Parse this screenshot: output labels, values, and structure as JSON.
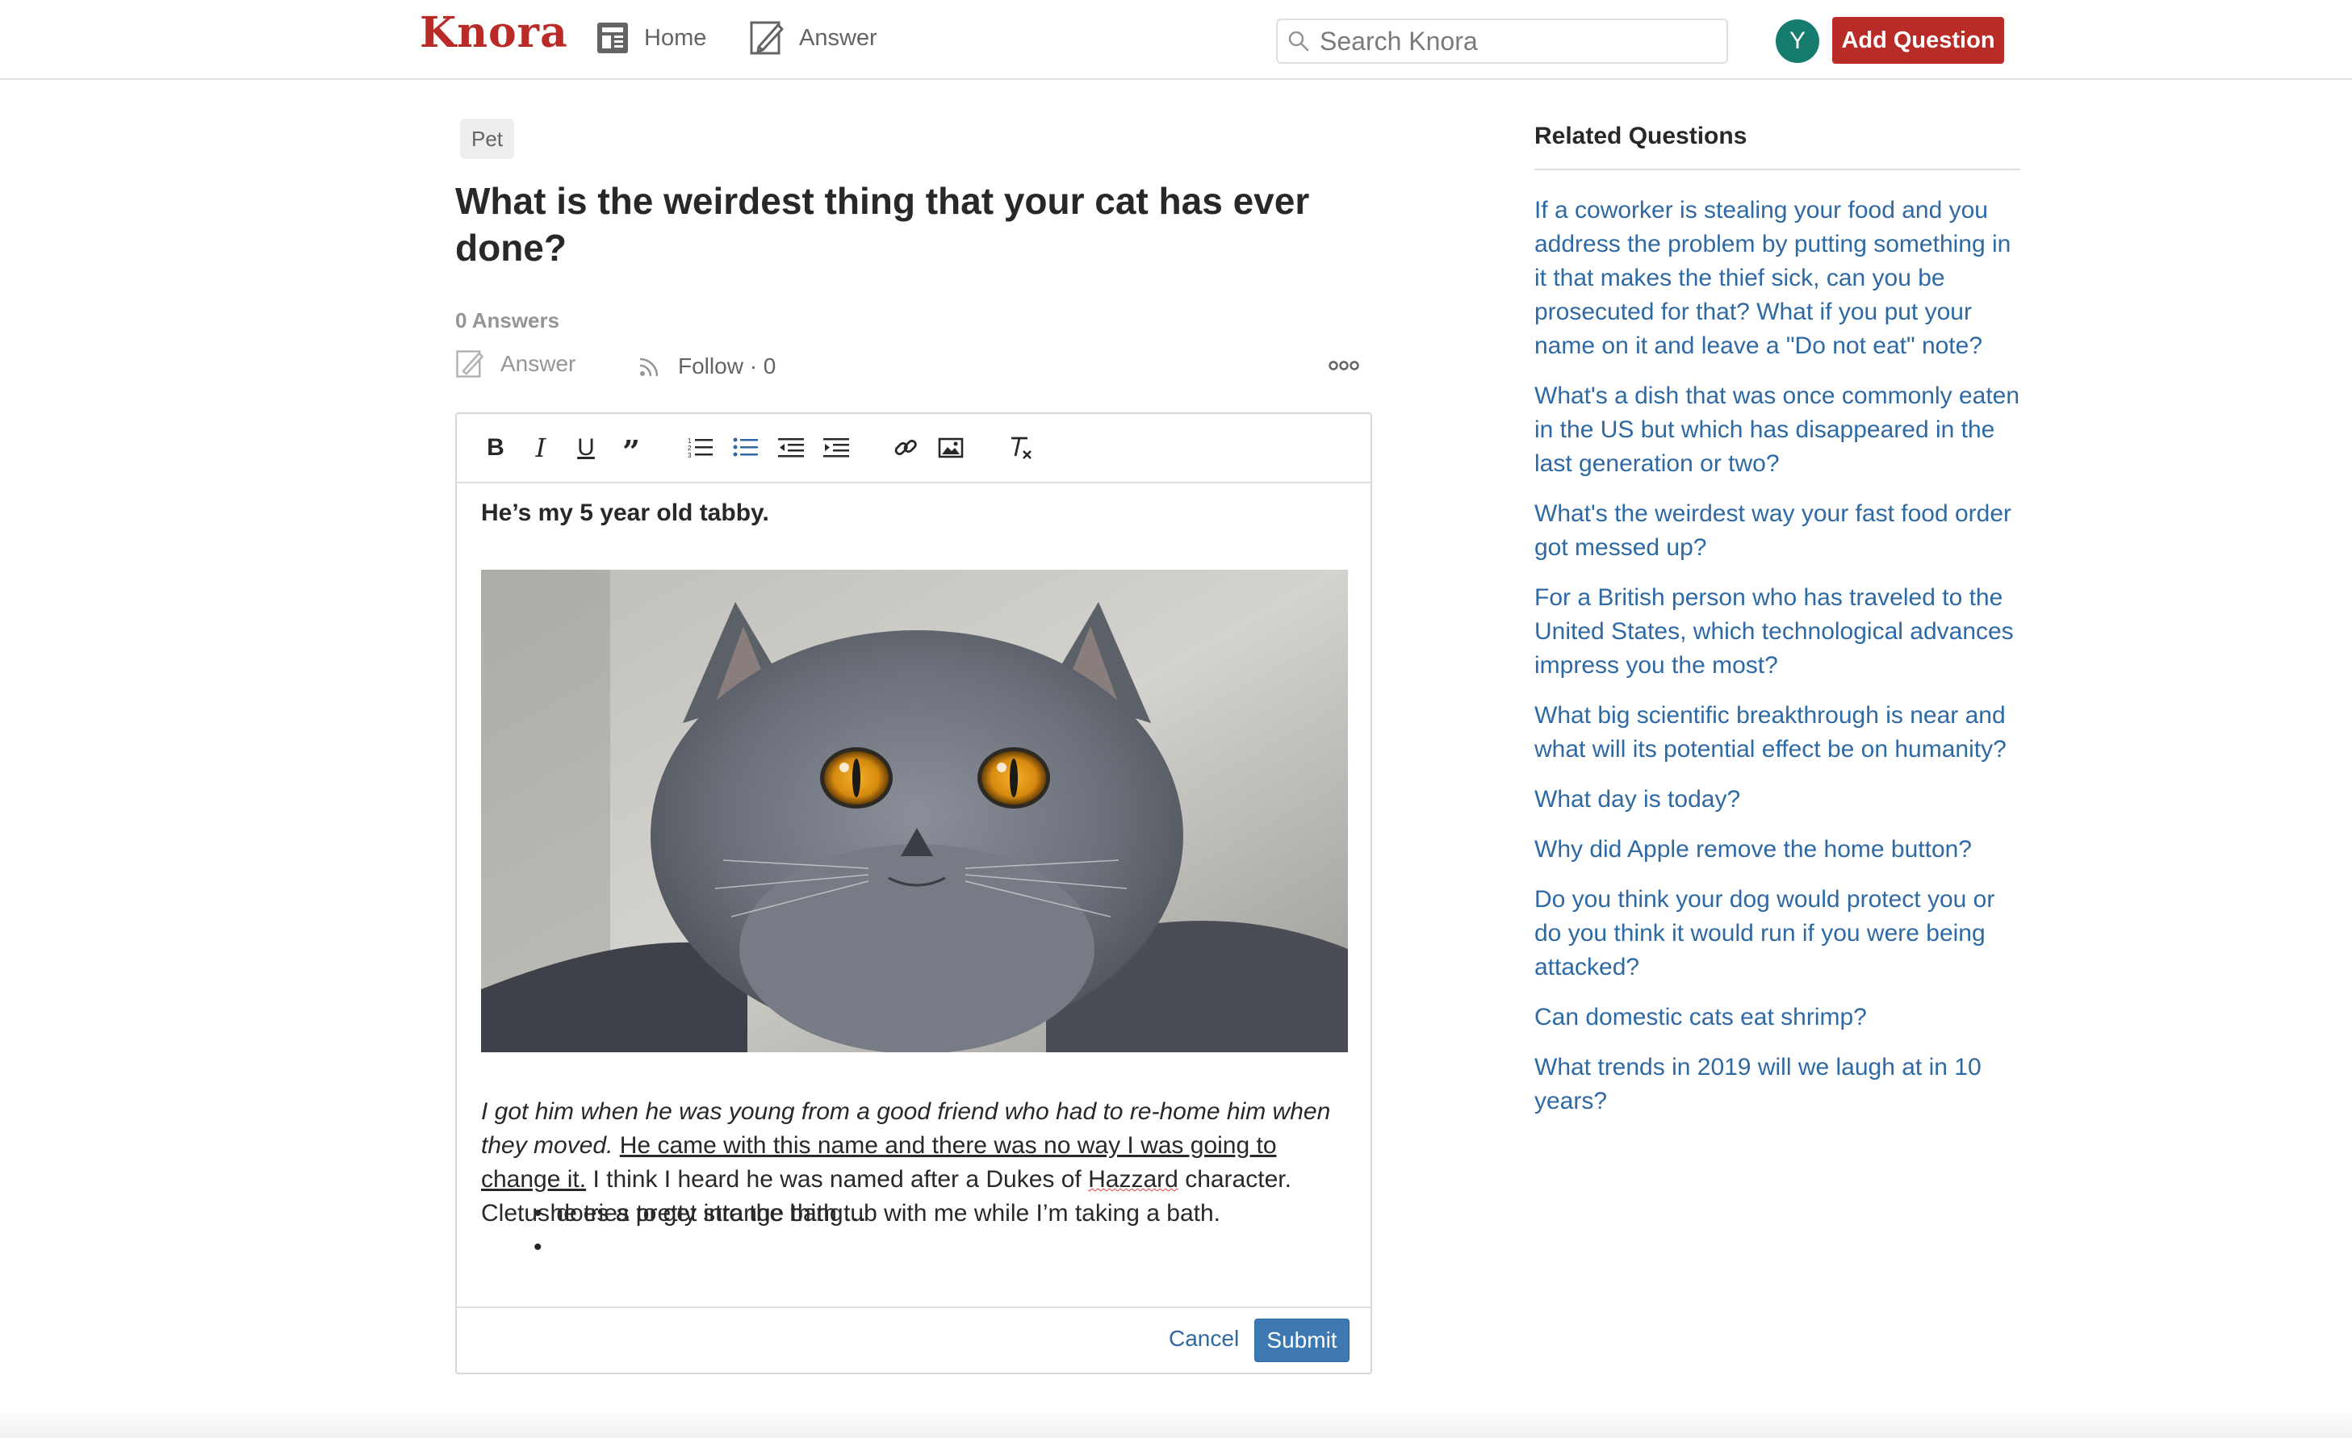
{
  "header": {
    "logo": "Knora",
    "nav_home": "Home",
    "nav_answer": "Answer",
    "search_placeholder": "Search Knora",
    "avatar_initial": "Y",
    "add_question": "Add Question",
    "brand_color": "#b92b27"
  },
  "question": {
    "topic_tag": "Pet",
    "title": "What is the weirdest thing that your cat has ever done?",
    "answers_count": "0 Answers",
    "answer_action": "Answer",
    "follow_action": "Follow · 0",
    "more_icon": "ooo"
  },
  "editor": {
    "toolbar_icons": [
      "bold-icon",
      "italic-icon",
      "underline-icon",
      "quote-icon",
      "ordered-list-icon",
      "bullet-list-icon",
      "outdent-icon",
      "indent-icon",
      "link-icon",
      "image-icon",
      "clear-format-icon"
    ],
    "intro_bold": "He’s my 5 year old tabby.",
    "para_italic": "I got him when he was young from a good friend who had to re-home him when they moved.",
    "para_underline": "He came with this name and there was no way I was going to change it.",
    "para_text_1": "I think I heard he was named after a Dukes of",
    "para_misspelled": "Hazzard",
    "para_text_2": "character. Cletus does a pretty strange thing…",
    "bullets": [
      "he tries to get into the bath tub with me while I’m taking a bath.",
      ""
    ],
    "cancel": "Cancel",
    "submit": "Submit"
  },
  "sidebar": {
    "title": "Related Questions",
    "questions": [
      "If a coworker is stealing your food and you address the problem by putting something in it that makes the thief sick, can you be prosecuted for that? What if you put your name on it and leave a \"Do not eat\" note?",
      "What's a dish that was once commonly eaten in the US but which has disappeared in the last generation or two?",
      "What's the weirdest way your fast food order got messed up?",
      "For a British person who has traveled to the United States, which technological advances impress you the most?",
      "What big scientific breakthrough is near and what will its potential effect be on humanity?",
      "What day is today?",
      "Why did Apple remove the home button?",
      "Do you think your dog would protect you or do you think it would run if you were being attacked?",
      "Can domestic cats eat shrimp?",
      "What trends in 2019 will we laugh at in 10 years?"
    ],
    "link_color": "#2e69a3"
  }
}
